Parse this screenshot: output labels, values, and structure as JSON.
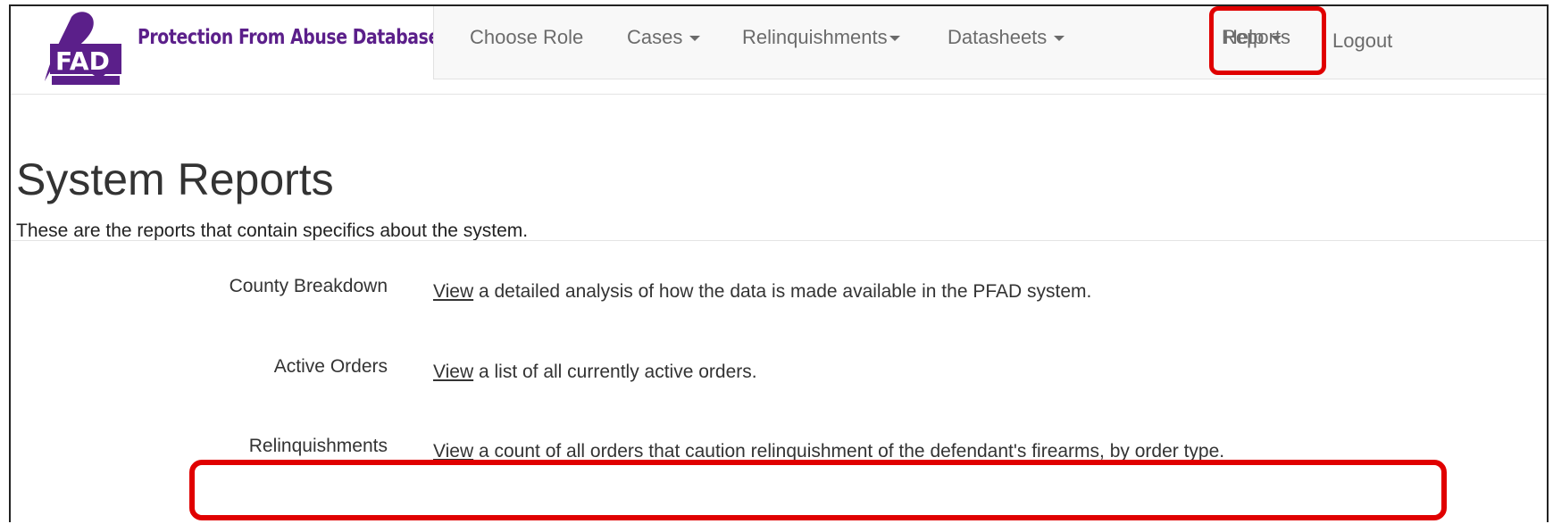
{
  "app": {
    "title": "Protection From Abuse Database",
    "logo_text": "PFAD"
  },
  "nav": {
    "choose_role": "Choose Role",
    "cases": "Cases",
    "relinquishments": "Relinquishments",
    "datasheets": "Datasheets",
    "reports": "Reports",
    "help": "Help",
    "logout": "Logout"
  },
  "page": {
    "title": "System Reports",
    "subtitle": "These are the reports that contain specifics about the system."
  },
  "reports": [
    {
      "label": "County Breakdown",
      "link": "View",
      "desc": " a detailed analysis of how the data is made available in the PFAD system."
    },
    {
      "label": "Active Orders",
      "link": "View",
      "desc": " a list of all currently active orders."
    },
    {
      "label": "Relinquishments",
      "link": "View",
      "desc": " a count of all orders that caution relinquishment of the defendant's firearms, by order type."
    }
  ],
  "colors": {
    "brand": "#5b1f8a",
    "highlight": "#e00000"
  },
  "icons": {
    "logo": "ribbon-lock-logo-icon"
  }
}
